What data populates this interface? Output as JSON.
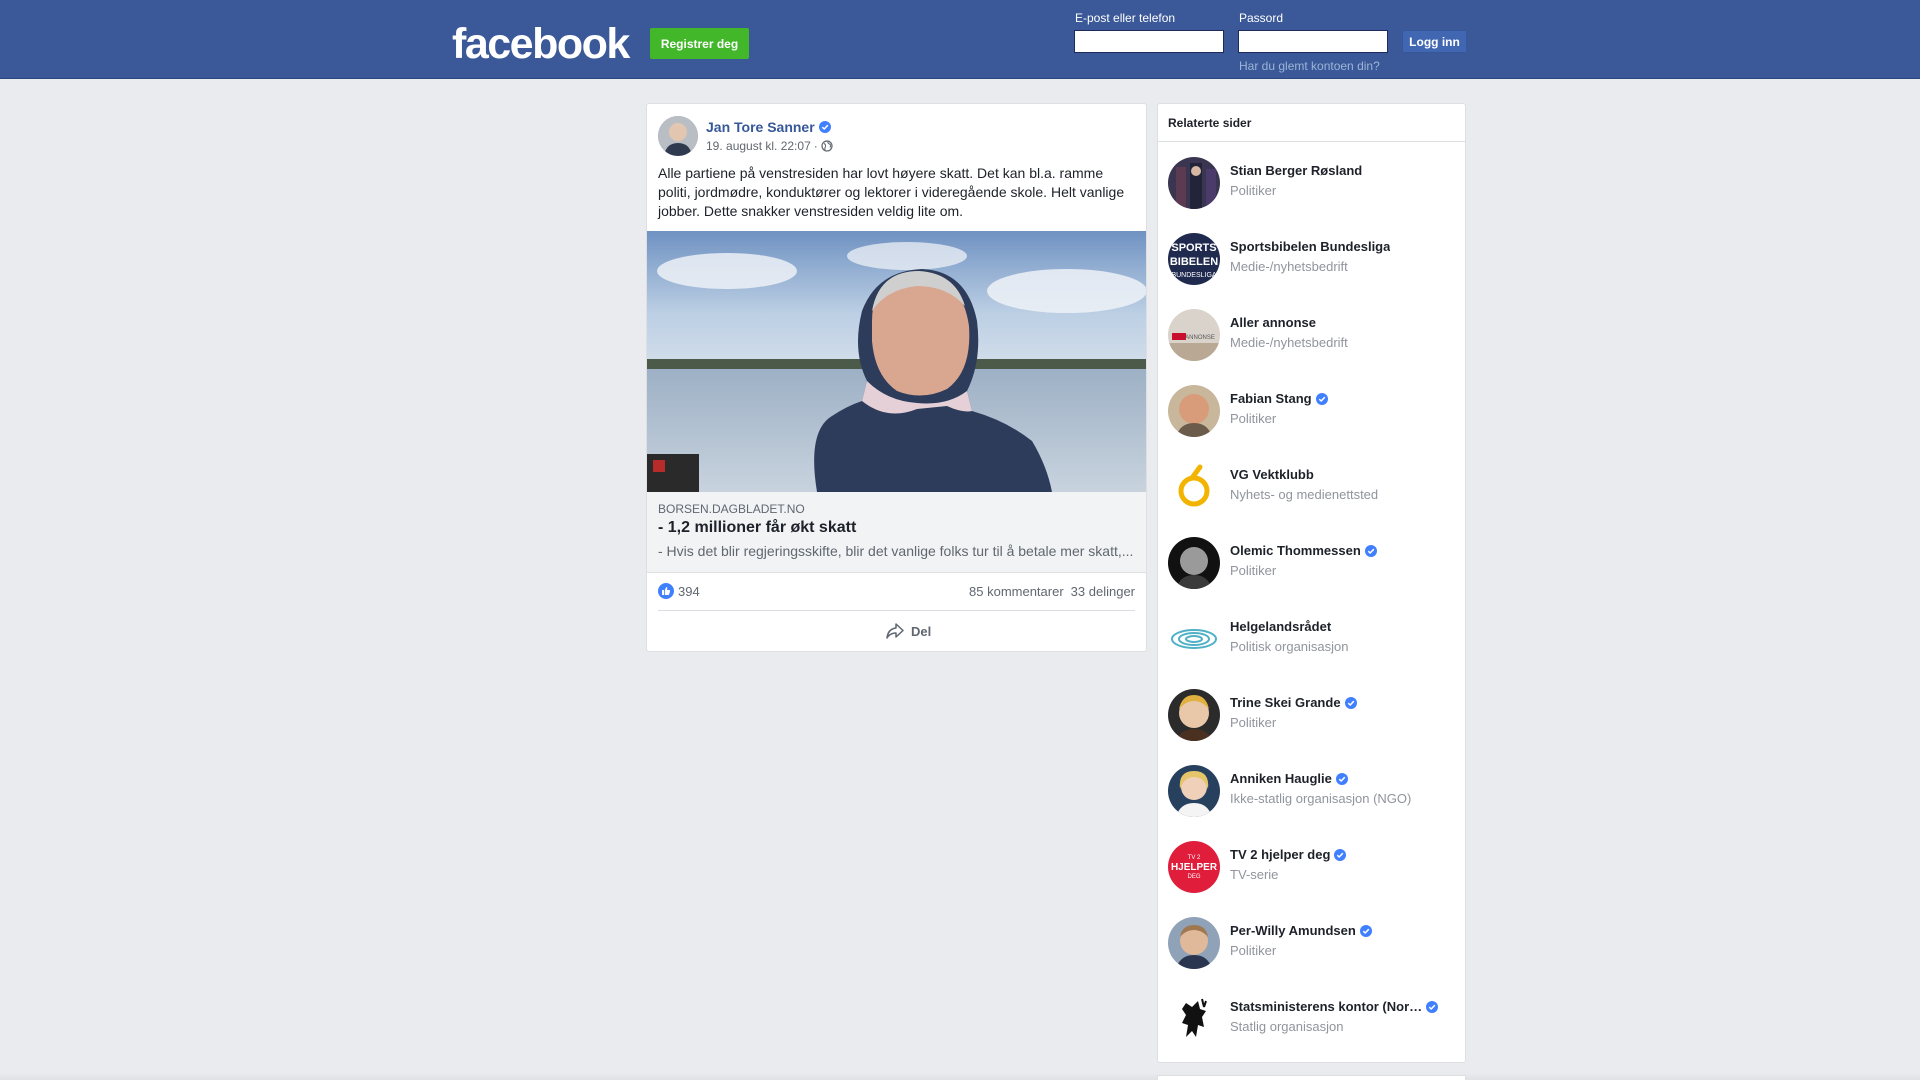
{
  "header": {
    "logo": "facebook",
    "register_label": "Registrer deg",
    "email_label": "E-post eller telefon",
    "password_label": "Passord",
    "email_value": "",
    "password_value": "",
    "login_label": "Logg inn",
    "forgot_label": "Har du glemt kontoen din?"
  },
  "post": {
    "author": "Jan Tore Sanner",
    "verified": true,
    "date": "19. august kl. 22:07",
    "meta_sep": "·",
    "privacy_icon": "globe-icon",
    "text": "Alle partiene på venstresiden har lovt høyere skatt. Det kan bl.a. ramme politi, jordmødre, konduktører og lektorer i videregående skole. Helt vanlige jobber. Dette snakker venstresiden veldig lite om.",
    "link": {
      "domain": "BORSEN.DAGBLADET.NO",
      "title": "- 1,2 millioner får økt skatt",
      "description": "- Hvis det blir regjeringsskifte, blir det vanlige folks tur til å betale mer skatt,..."
    },
    "likes": "394",
    "comments": "85 kommentarer",
    "shares": "33 delinger",
    "share_label": "Del"
  },
  "related": {
    "title": "Relaterte sider",
    "items": [
      {
        "name": "Stian Berger Røsland",
        "category": "Politiker",
        "verified": false
      },
      {
        "name": "Sportsbibelen Bundesliga",
        "category": "Medie-/nyhetsbedrift",
        "verified": false
      },
      {
        "name": "Aller annonse",
        "category": "Medie-/nyhetsbedrift",
        "verified": false
      },
      {
        "name": "Fabian Stang",
        "category": "Politiker",
        "verified": true
      },
      {
        "name": "VG Vektklubb",
        "category": "Nyhets- og medienettsted",
        "verified": false
      },
      {
        "name": "Olemic Thommessen",
        "category": "Politiker",
        "verified": true
      },
      {
        "name": "Helgelandsrådet",
        "category": "Politisk organisasjon",
        "verified": false
      },
      {
        "name": "Trine Skei Grande",
        "category": "Politiker",
        "verified": true
      },
      {
        "name": "Anniken Hauglie",
        "category": "Ikke-statlig organisasjon (NGO)",
        "verified": true
      },
      {
        "name": "TV 2 hjelper deg",
        "category": "TV-serie",
        "verified": true
      },
      {
        "name": "Per-Willy Amundsen",
        "category": "Politiker",
        "verified": true
      },
      {
        "name": "Statsministerens kontor (Nor…",
        "category": "Statlig organisasjon",
        "verified": true
      }
    ]
  },
  "colors": {
    "header_bg": "#3b5998",
    "register_green": "#42b72a",
    "link_blue": "#365899",
    "verified_blue": "#4080ff"
  }
}
